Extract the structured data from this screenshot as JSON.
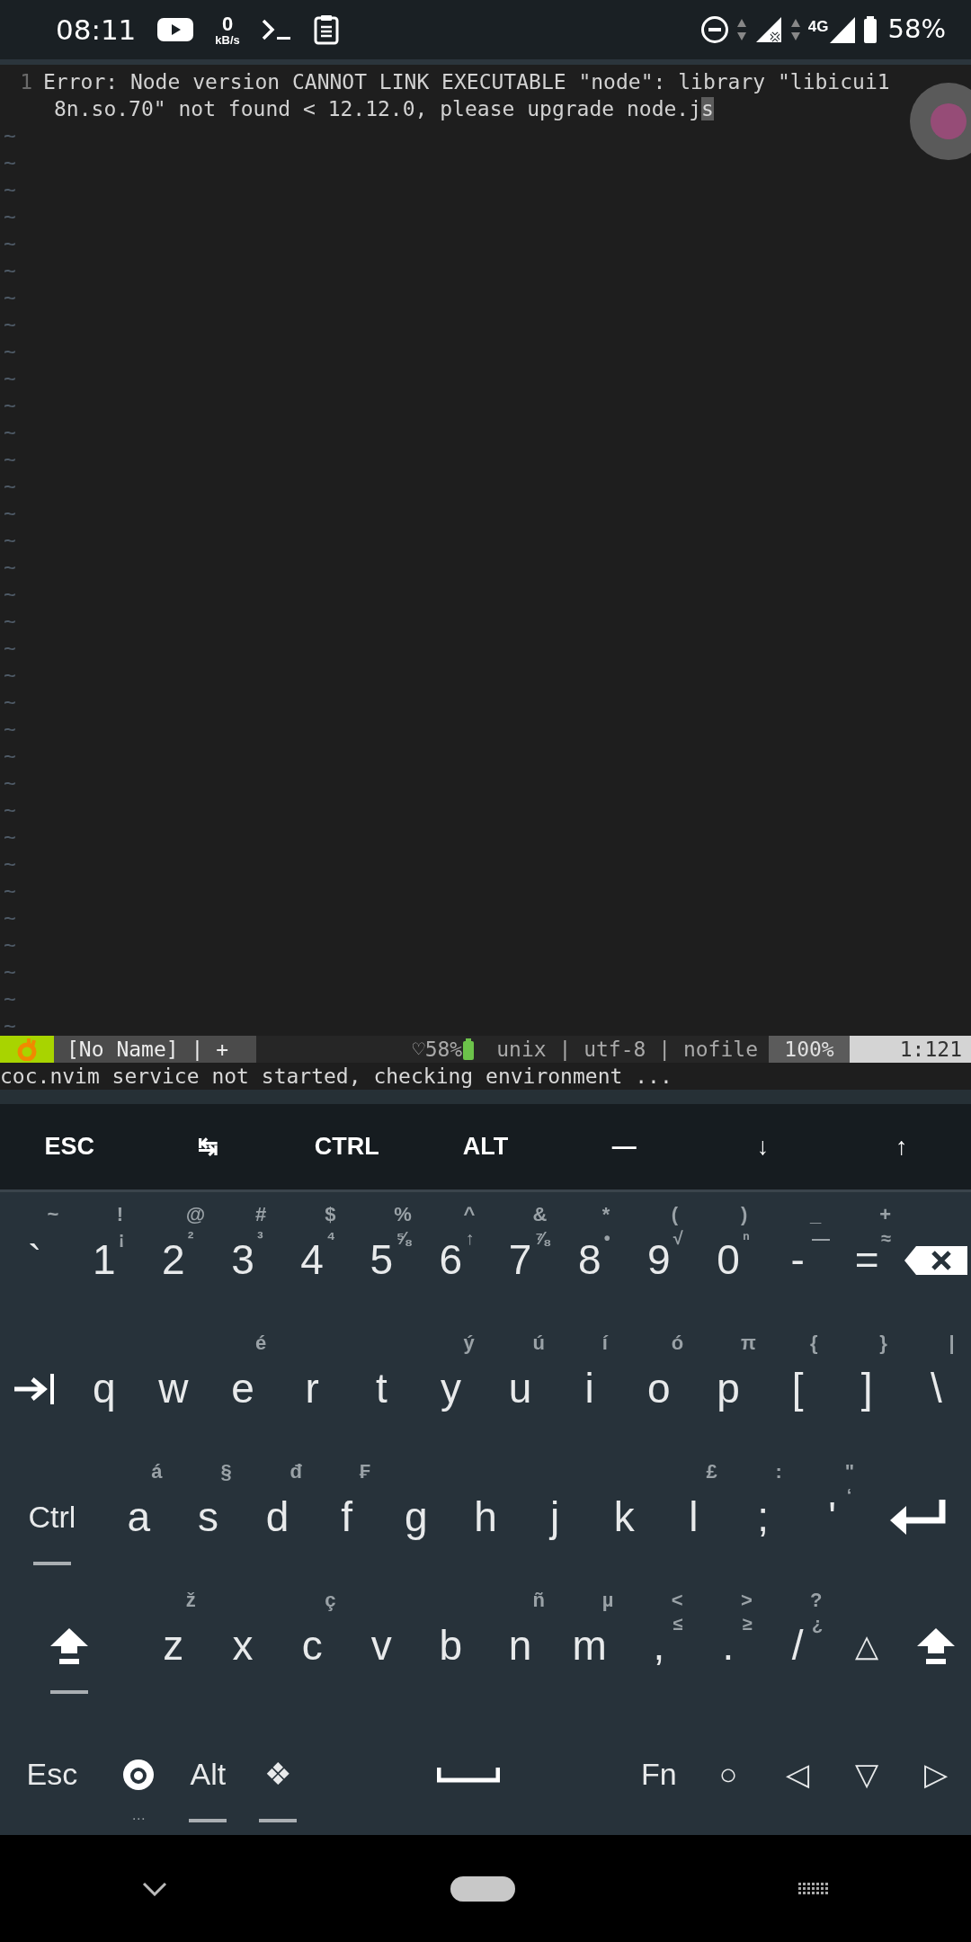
{
  "status_bar": {
    "time": "08:11",
    "net_speed": "0",
    "net_unit": "kB/s",
    "network_type": "4G",
    "battery": "58%"
  },
  "editor": {
    "lines": [
      {
        "number": "1",
        "rows": [
          "Error: Node version CANNOT LINK EXECUTABLE \"node\": library \"libicui1",
          "8n.so.70\" not found < 12.12.0, please upgrade node.j"
        ],
        "cursor": "s"
      }
    ],
    "filler": [
      "~",
      "~",
      "~",
      "~",
      "~",
      "~",
      "~",
      "~",
      "~",
      "~",
      "~",
      "~",
      "~",
      "~",
      "~",
      "~",
      "~",
      "~",
      "~",
      "~",
      "~",
      "~",
      "~",
      "~",
      "~",
      "~",
      "~",
      "~",
      "~",
      "~",
      "~",
      "~",
      "~",
      "~"
    ]
  },
  "statusline": {
    "file": "[No Name] | +",
    "battery": "♡58%",
    "file_info": "unix | utf-8 | nofile",
    "percent": "100%",
    "position": "1:121"
  },
  "message": "coc.nvim service not started, checking environment ...",
  "extra_keys": [
    "ESC",
    "↹",
    "CTRL",
    "ALT",
    "—",
    "↓",
    "↑"
  ],
  "keyboard": [
    [
      {
        "kind": "char",
        "main": "`",
        "top": "~"
      },
      {
        "kind": "char",
        "main": "1",
        "top": "!",
        "side": "¡"
      },
      {
        "kind": "char",
        "main": "2",
        "top": "@",
        "side": "²"
      },
      {
        "kind": "char",
        "main": "3",
        "top": "#",
        "side": "³"
      },
      {
        "kind": "char",
        "main": "4",
        "top": "$",
        "side": "⁴"
      },
      {
        "kind": "char",
        "main": "5",
        "top": "%",
        "side": "⅝"
      },
      {
        "kind": "char",
        "main": "6",
        "top": "^",
        "side": "↑"
      },
      {
        "kind": "char",
        "main": "7",
        "top": "&",
        "side": "⅞"
      },
      {
        "kind": "char",
        "main": "8",
        "top": "*",
        "side": "•"
      },
      {
        "kind": "char",
        "main": "9",
        "top": "(",
        "side": "√"
      },
      {
        "kind": "char",
        "main": "0",
        "top": ")",
        "side": "ⁿ"
      },
      {
        "kind": "char",
        "main": "-",
        "top": "_",
        "side": "—"
      },
      {
        "kind": "char",
        "main": "=",
        "top": "+",
        "side": "≈"
      },
      {
        "kind": "backspace"
      }
    ],
    [
      {
        "kind": "tab"
      },
      {
        "kind": "char",
        "main": "q"
      },
      {
        "kind": "char",
        "main": "w"
      },
      {
        "kind": "char",
        "main": "e",
        "top": "é"
      },
      {
        "kind": "char",
        "main": "r"
      },
      {
        "kind": "char",
        "main": "t"
      },
      {
        "kind": "char",
        "main": "y",
        "top": "ý"
      },
      {
        "kind": "char",
        "main": "u",
        "top": "ú"
      },
      {
        "kind": "char",
        "main": "i",
        "top": "í"
      },
      {
        "kind": "char",
        "main": "o",
        "top": "ó"
      },
      {
        "kind": "char",
        "main": "p",
        "top": "π"
      },
      {
        "kind": "char",
        "main": "[",
        "top": "{"
      },
      {
        "kind": "char",
        "main": "]",
        "top": "}"
      },
      {
        "kind": "char",
        "main": "\\",
        "top": "|"
      }
    ],
    [
      {
        "kind": "word",
        "main": "Ctrl",
        "indicator": true
      },
      {
        "kind": "char",
        "main": "a",
        "top": "á"
      },
      {
        "kind": "char",
        "main": "s",
        "top": "§"
      },
      {
        "kind": "char",
        "main": "d",
        "top": "đ"
      },
      {
        "kind": "char",
        "main": "f",
        "top": "₣"
      },
      {
        "kind": "char",
        "main": "g"
      },
      {
        "kind": "char",
        "main": "h"
      },
      {
        "kind": "char",
        "main": "j"
      },
      {
        "kind": "char",
        "main": "k"
      },
      {
        "kind": "char",
        "main": "l",
        "top": "£"
      },
      {
        "kind": "char",
        "main": ";",
        "top": ":"
      },
      {
        "kind": "char",
        "main": "'",
        "top": "\"",
        "side": "‘"
      },
      {
        "kind": "enter"
      }
    ],
    [
      {
        "kind": "shift",
        "indicator": true
      },
      {
        "kind": "char",
        "main": "z",
        "top": "ž"
      },
      {
        "kind": "char",
        "main": "x"
      },
      {
        "kind": "char",
        "main": "c",
        "top": "ç"
      },
      {
        "kind": "char",
        "main": "v"
      },
      {
        "kind": "char",
        "main": "b"
      },
      {
        "kind": "char",
        "main": "n",
        "top": "ñ"
      },
      {
        "kind": "char",
        "main": "m",
        "top": "µ"
      },
      {
        "kind": "char",
        "main": ",",
        "top": "<",
        "side": "≤"
      },
      {
        "kind": "char",
        "main": ".",
        "top": ">",
        "side": "≥"
      },
      {
        "kind": "char",
        "main": "/",
        "top": "?",
        "side": "¿"
      },
      {
        "kind": "word",
        "main": "△"
      },
      {
        "kind": "shift"
      }
    ],
    [
      {
        "kind": "word",
        "main": "Esc"
      },
      {
        "kind": "settings",
        "below": "…"
      },
      {
        "kind": "word",
        "main": "Alt",
        "indicator": true
      },
      {
        "kind": "word",
        "main": "❖",
        "indicator": true
      },
      {
        "kind": "space"
      },
      {
        "kind": "word",
        "main": "Fn"
      },
      {
        "kind": "word",
        "main": "○"
      },
      {
        "kind": "word",
        "main": "◁"
      },
      {
        "kind": "word",
        "main": "▽"
      },
      {
        "kind": "word",
        "main": "▷"
      }
    ]
  ]
}
